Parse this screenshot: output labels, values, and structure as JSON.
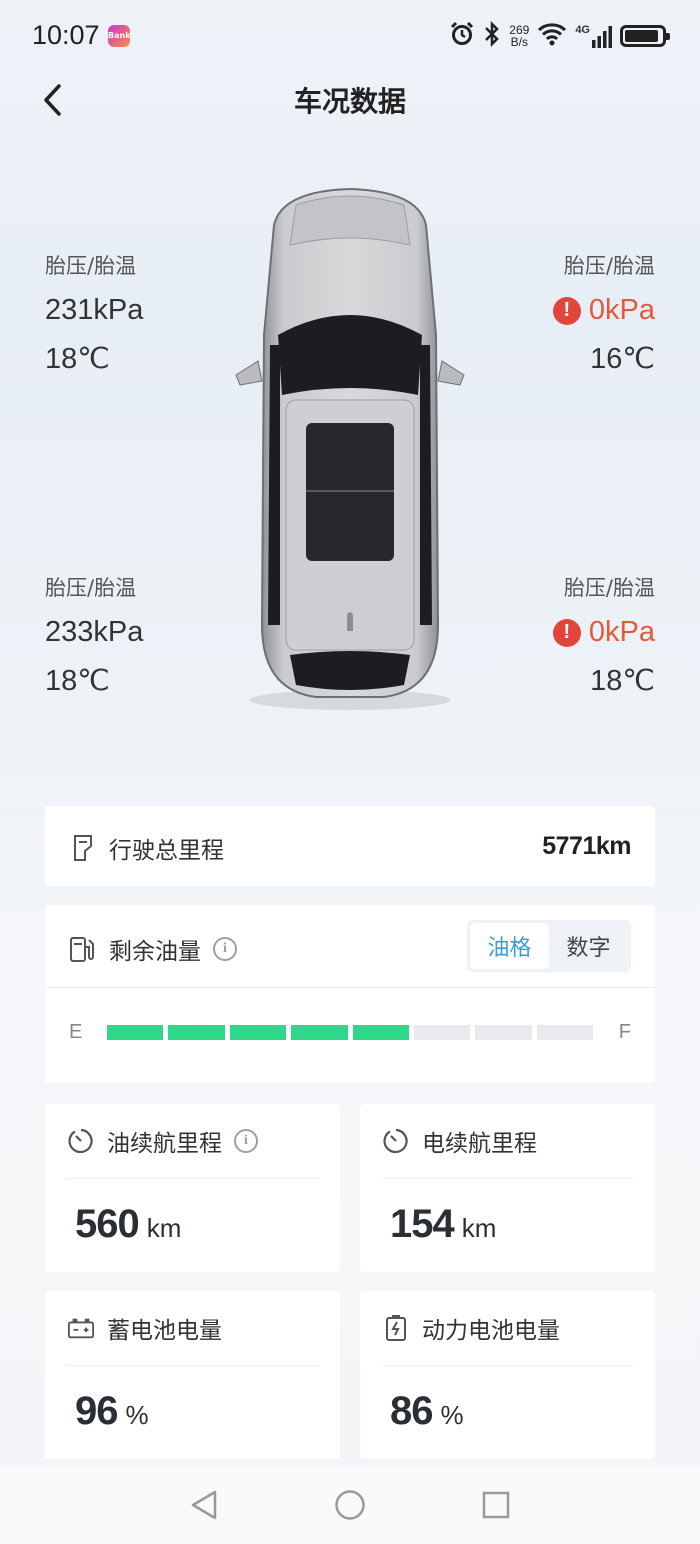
{
  "status_bar": {
    "time": "10:07",
    "app_badge": "Bank",
    "net_speed_value": "269",
    "net_speed_unit": "B/s",
    "network": "4G",
    "battery_level": 0.92
  },
  "header": {
    "title": "车况数据",
    "back_icon": "chevron-left-icon"
  },
  "tires": {
    "front_left": {
      "label": "胎压/胎温",
      "pressure": "231kPa",
      "temperature": "18℃",
      "warning": false
    },
    "front_right": {
      "label": "胎压/胎温",
      "pressure": "0kPa",
      "temperature": "16℃",
      "warning": true
    },
    "rear_left": {
      "label": "胎压/胎温",
      "pressure": "233kPa",
      "temperature": "18℃",
      "warning": false
    },
    "rear_right": {
      "label": "胎压/胎温",
      "pressure": "0kPa",
      "temperature": "18℃",
      "warning": true
    },
    "warning_color": "#e05a3c"
  },
  "total_mileage": {
    "label": "行驶总里程",
    "value": "5771km",
    "icon": "odometer-icon"
  },
  "fuel": {
    "label": "剩余油量",
    "icon": "fuel-pump-icon",
    "toggle_options": [
      "油格",
      "数字"
    ],
    "selected_option": "油格",
    "empty_label": "E",
    "full_label": "F",
    "segments_total": 8,
    "segments_filled": 5,
    "fill_color": "#2fd78a"
  },
  "fuel_range": {
    "label": "油续航里程",
    "value": "560",
    "unit": "km",
    "icon": "gauge-icon"
  },
  "electric_range": {
    "label": "电续航里程",
    "value": "154",
    "unit": "km",
    "icon": "gauge-icon"
  },
  "battery_12v": {
    "label": "蓄电池电量",
    "value": "96",
    "unit": "%",
    "icon": "car-battery-icon"
  },
  "power_battery": {
    "label": "动力电池电量",
    "value": "86",
    "unit": "%",
    "icon": "charging-battery-icon"
  },
  "nav": {
    "back": "triangle-back-icon",
    "home": "circle-home-icon",
    "recents": "square-recents-icon"
  }
}
